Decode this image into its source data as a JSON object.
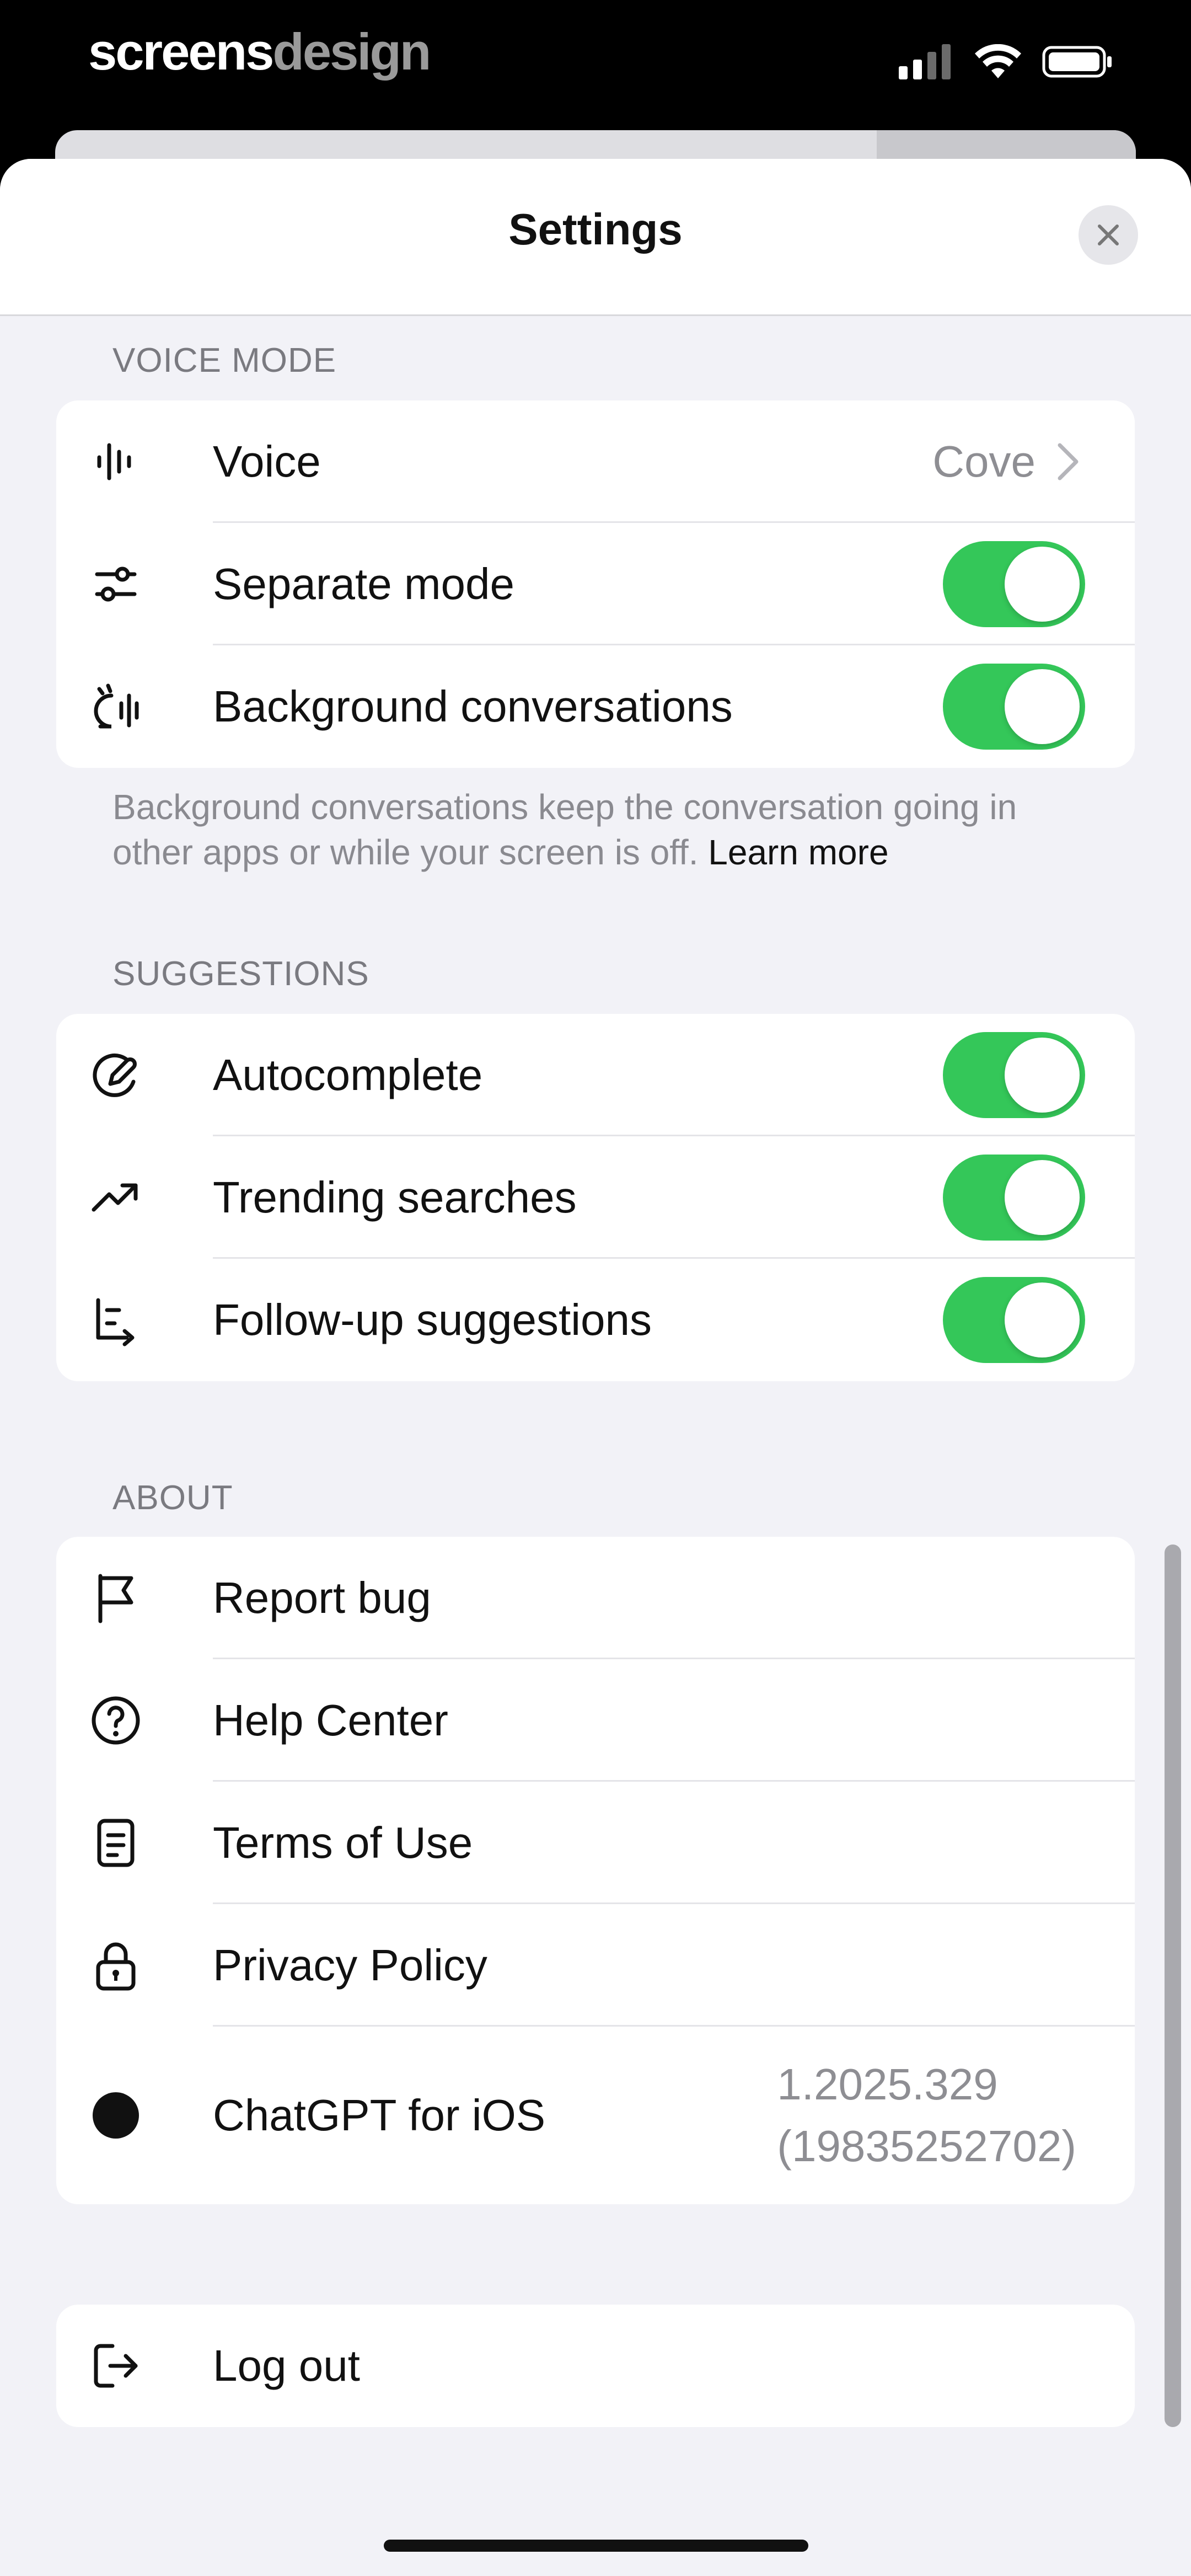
{
  "status_bar": {
    "brand_part1": "screens",
    "brand_part2": "design"
  },
  "header": {
    "title": "Settings"
  },
  "voice_mode": {
    "section_label": "VOICE MODE",
    "items": [
      {
        "label": "Voice",
        "value": "Cove",
        "icon": "waveform-icon"
      },
      {
        "label": "Separate mode",
        "toggle": true,
        "icon": "sliders-icon"
      },
      {
        "label": "Background conversations",
        "toggle": true,
        "icon": "background-voice-icon"
      }
    ],
    "footnote": "Background conversations keep the conversation going in other apps or while your screen is off.",
    "footnote_link": "Learn more"
  },
  "suggestions": {
    "section_label": "SUGGESTIONS",
    "items": [
      {
        "label": "Autocomplete",
        "toggle": true,
        "icon": "autocomplete-icon"
      },
      {
        "label": "Trending searches",
        "toggle": true,
        "icon": "trending-icon"
      },
      {
        "label": "Follow-up suggestions",
        "toggle": true,
        "icon": "follow-up-icon"
      }
    ]
  },
  "about": {
    "section_label": "ABOUT",
    "items": [
      {
        "label": "Report bug",
        "icon": "flag-icon"
      },
      {
        "label": "Help Center",
        "icon": "question-circle-icon"
      },
      {
        "label": "Terms of Use",
        "icon": "document-icon"
      },
      {
        "label": "Privacy Policy",
        "icon": "lock-icon"
      },
      {
        "label": "ChatGPT for iOS",
        "icon": "app-dot-icon",
        "version_line1": "1.2025.329",
        "version_line2": "(19835252702)"
      }
    ]
  },
  "account": {
    "logout_label": "Log out",
    "icon": "logout-icon"
  },
  "colors": {
    "toggle_on": "#34c759",
    "background": "#f2f2f7",
    "secondary_text": "#8e8e93"
  }
}
